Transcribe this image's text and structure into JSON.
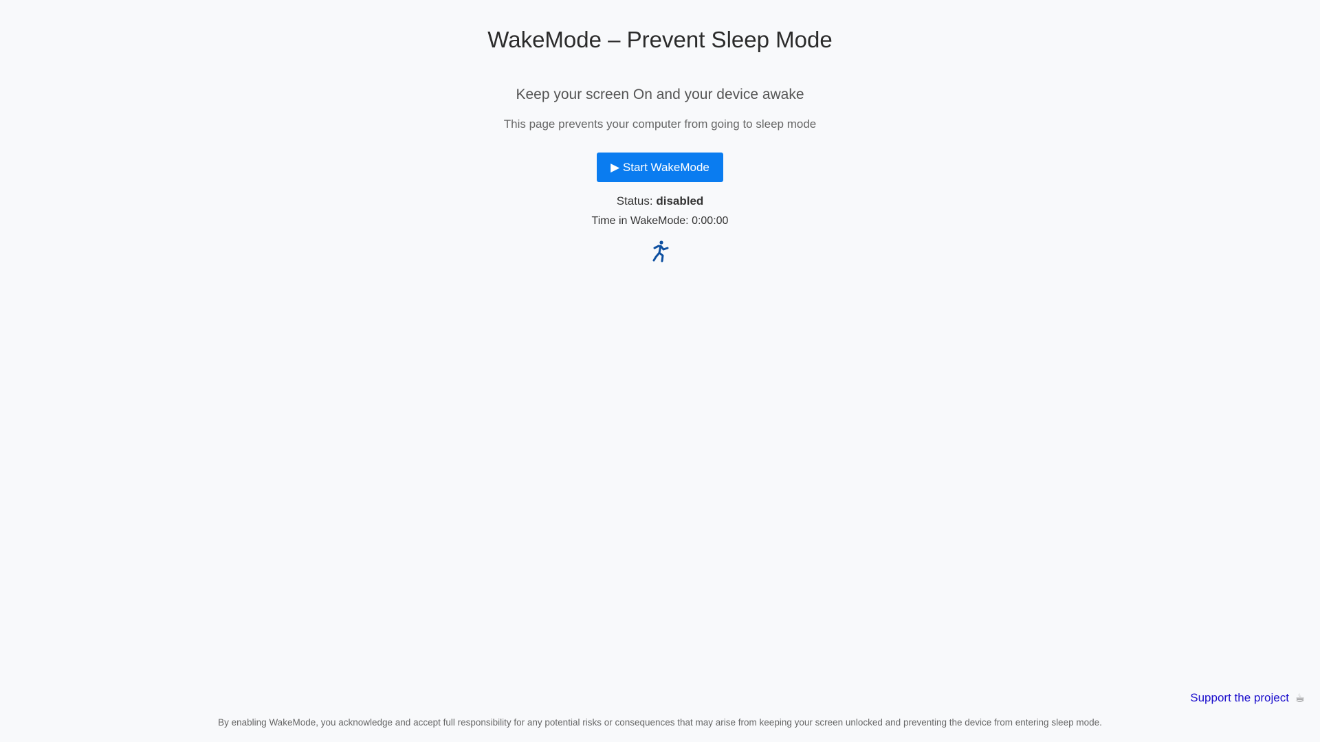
{
  "header": {
    "title": "WakeMode – Prevent Sleep Mode"
  },
  "main": {
    "subtitle": "Keep your screen On and your device awake",
    "description": "This page prevents your computer from going to sleep mode",
    "start_button_label": "▶ Start WakeMode",
    "status_label": "Status:",
    "status_value": "disabled",
    "timer_label": "Time in WakeMode:",
    "timer_value": "0:00:00",
    "icon": "running-person-icon"
  },
  "footer": {
    "support_label": "Support the project",
    "support_icon": "coffee-icon",
    "support_icon_glyph": "☕",
    "disclaimer": "By enabling WakeMode, you acknowledge and accept full responsibility for any potential risks or consequences that may arise from keeping your screen unlocked and preventing the device from entering sleep mode."
  },
  "colors": {
    "background": "#f8f9fb",
    "accent": "#0a7cf0",
    "link": "#1a0dcc",
    "icon": "#0d4fa0"
  }
}
